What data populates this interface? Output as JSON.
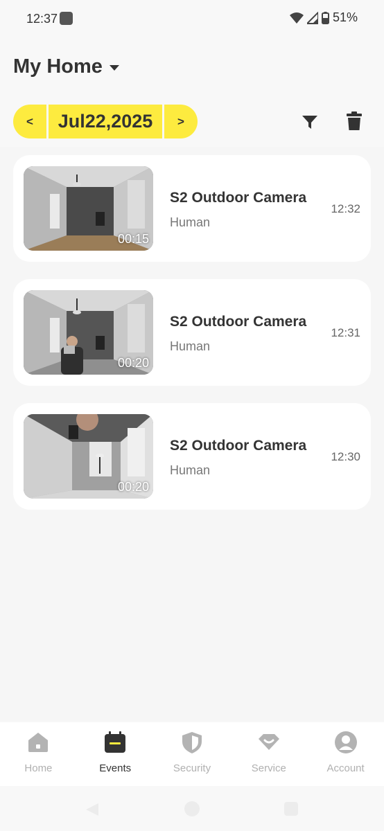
{
  "status_bar": {
    "time": "12:37",
    "battery": "51%"
  },
  "header": {
    "home_title": "My Home"
  },
  "date_selector": {
    "prev_label": "<",
    "date": "Jul22,2025",
    "next_label": ">"
  },
  "events": [
    {
      "camera": "S2 Outdoor Camera",
      "type": "Human",
      "time": "12:32",
      "duration": "00:15"
    },
    {
      "camera": "S2 Outdoor Camera",
      "type": "Human",
      "time": "12:31",
      "duration": "00:20"
    },
    {
      "camera": "S2 Outdoor Camera",
      "type": "Human",
      "time": "12:30",
      "duration": "00:20"
    }
  ],
  "bottom_nav": {
    "items": [
      {
        "label": "Home",
        "icon": "home-icon",
        "active": false
      },
      {
        "label": "Events",
        "icon": "calendar-icon",
        "active": true
      },
      {
        "label": "Security",
        "icon": "shield-icon",
        "active": false
      },
      {
        "label": "Service",
        "icon": "service-icon",
        "active": false
      },
      {
        "label": "Account",
        "icon": "account-icon",
        "active": false
      }
    ]
  },
  "colors": {
    "accent": "#fdeb3f",
    "text": "#333333",
    "muted": "#b0b0b0"
  }
}
